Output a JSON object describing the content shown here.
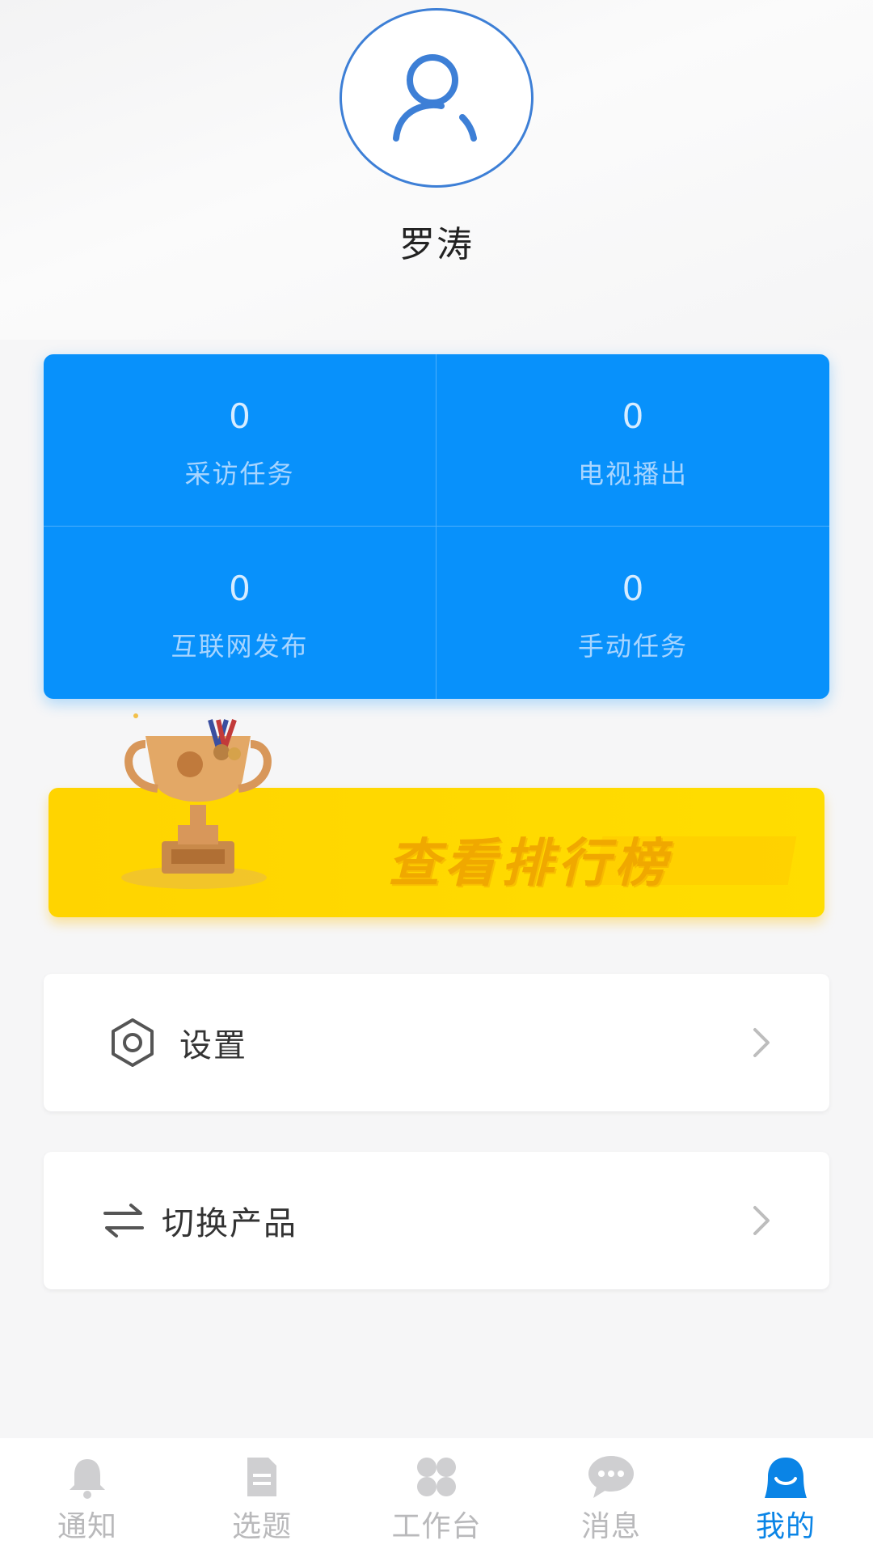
{
  "profile": {
    "username": "罗涛"
  },
  "stats": [
    {
      "value": "0",
      "label": "采访任务"
    },
    {
      "value": "0",
      "label": "电视播出"
    },
    {
      "value": "0",
      "label": "互联网发布"
    },
    {
      "value": "0",
      "label": "手动任务"
    }
  ],
  "banner": {
    "label": "查看排行榜"
  },
  "menu": {
    "settings": {
      "label": "设置",
      "icon": "hexagon-gear-icon"
    },
    "switch_product": {
      "label": "切换产品",
      "icon": "swap-arrows-icon"
    }
  },
  "tabbar": {
    "items": [
      {
        "label": "通知",
        "icon": "bell-icon"
      },
      {
        "label": "选题",
        "icon": "document-icon"
      },
      {
        "label": "工作台",
        "icon": "grid-icon"
      },
      {
        "label": "消息",
        "icon": "chat-bubble-icon"
      },
      {
        "label": "我的",
        "icon": "user-face-icon"
      }
    ],
    "active_index": 4,
    "active_color": "#0a84e6",
    "inactive_color": "#b9b9bb"
  },
  "colors": {
    "stats_bg": "#0891fb",
    "banner_bg": "#ffd400",
    "avatar_border": "#3d7fd6"
  }
}
